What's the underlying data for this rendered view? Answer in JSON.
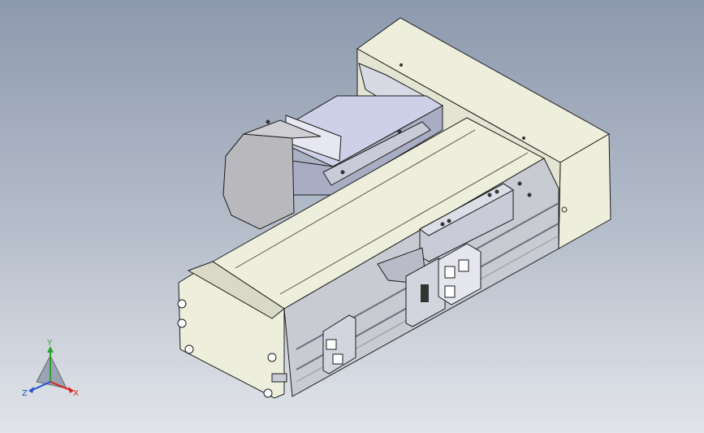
{
  "viewport": {
    "background_top": "#8d99ad",
    "background_bottom": "#e2e5ea"
  },
  "model": {
    "body_color": "#eeeedd",
    "shade_color": "#d9d9c8",
    "rail_color": "#c8cbd2",
    "motor_color": "#cdd0e6",
    "motor_shadow": "#a9adc4",
    "block_color": "#c9ccd8",
    "edge_color": "#1c1c1c"
  },
  "triad": {
    "x_label": "X",
    "y_label": "Y",
    "z_label": "Z",
    "x_color": "#d92020",
    "y_color": "#2ca02c",
    "z_color": "#2050d0"
  }
}
